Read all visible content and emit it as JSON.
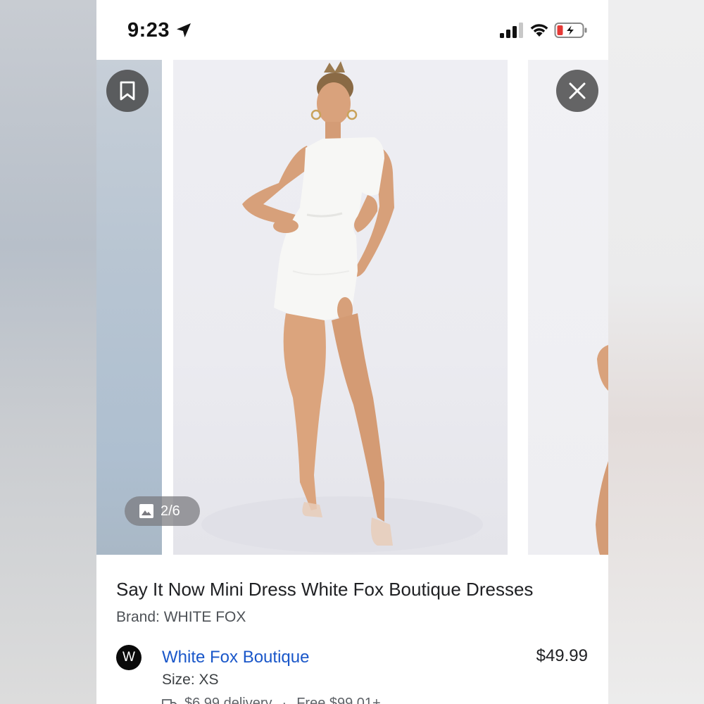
{
  "status_bar": {
    "time": "9:23"
  },
  "carousel": {
    "counter": "2/6",
    "current_image": 2,
    "total_images": 6
  },
  "product": {
    "title": "Say It Now Mini Dress White Fox Boutique Dresses",
    "brand": "Brand: WHITE FOX"
  },
  "seller": {
    "logo_letter": "W",
    "name": "White Fox Boutique",
    "price": "$49.99",
    "size": "Size: XS",
    "delivery": "$6.99 delivery",
    "free_shipping": "Free $99.01+"
  },
  "colors": {
    "link": "#1a57c9",
    "battery_low": "#e53935",
    "dress": "#f7f7f5"
  },
  "icons": {
    "location": "location-arrow-icon",
    "signal": "cellular-signal-icon",
    "wifi": "wifi-icon",
    "battery": "battery-charging-icon",
    "save": "bookmark-icon",
    "close": "close-icon",
    "gallery": "image-icon",
    "delivery": "truck-icon"
  }
}
